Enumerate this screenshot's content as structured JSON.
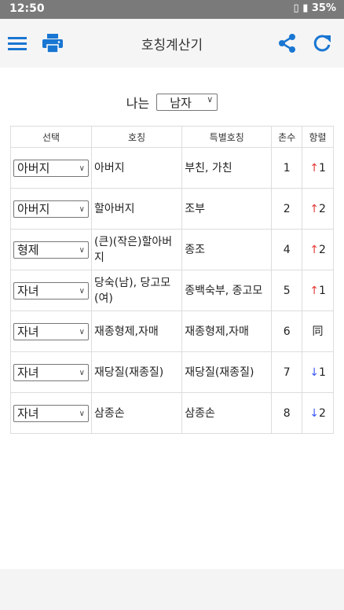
{
  "status_bar": {
    "time": "12:50",
    "battery": "35%"
  },
  "toolbar": {
    "title": "호칭계산기"
  },
  "gender": {
    "label": "나는",
    "value": "남자"
  },
  "table": {
    "headers": [
      "선택",
      "호칭",
      "특별호칭",
      "촌수",
      "항렬"
    ],
    "rows": [
      {
        "select": "아버지",
        "title": "아버지",
        "special": "부친, 가친",
        "chon": "1",
        "hang_arrow": "↑",
        "hang_value": "1",
        "direction": "up"
      },
      {
        "select": "아버지",
        "title": "할아버지",
        "special": "조부",
        "chon": "2",
        "hang_arrow": "↑",
        "hang_value": "2",
        "direction": "up"
      },
      {
        "select": "형제",
        "title": "(큰)(작은)할아버지",
        "special": "종조",
        "chon": "4",
        "hang_arrow": "↑",
        "hang_value": "2",
        "direction": "up"
      },
      {
        "select": "자녀",
        "title": "당숙(남), 당고모(여)",
        "special": "종백숙부, 종고모",
        "chon": "5",
        "hang_arrow": "↑",
        "hang_value": "1",
        "direction": "up"
      },
      {
        "select": "자녀",
        "title": "재종형제,자매",
        "special": "재종형제,자매",
        "chon": "6",
        "hang_arrow": "",
        "hang_value": "同",
        "direction": "same"
      },
      {
        "select": "자녀",
        "title": "재당질(재종질)",
        "special": "재당질(재종질)",
        "chon": "7",
        "hang_arrow": "↓",
        "hang_value": "1",
        "direction": "down"
      },
      {
        "select": "자녀",
        "title": "삼종손",
        "special": "삼종손",
        "chon": "8",
        "hang_arrow": "↓",
        "hang_value": "2",
        "direction": "down"
      }
    ]
  },
  "colors": {
    "accent": "#1976d2",
    "arrow_up": "#e53935",
    "arrow_down": "#3d5afe",
    "status_bar": "#7a7a7a"
  },
  "icons": [
    "menu-icon",
    "print-icon",
    "share-icon",
    "refresh-icon",
    "vibrate-icon",
    "battery-icon"
  ]
}
